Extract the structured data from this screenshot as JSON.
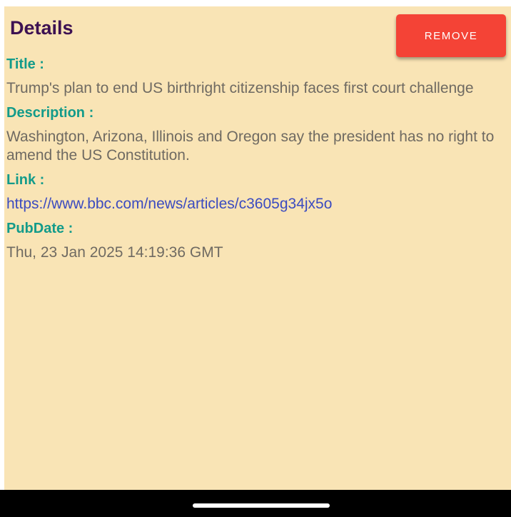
{
  "header": {
    "title": "Details",
    "remove_label": "REMOVE"
  },
  "details": {
    "title_label": "Title :",
    "title_value": "Trump's plan to end US birthright citizenship faces first court challenge",
    "description_label": "Description :",
    "description_value": "Washington, Arizona, Illinois and Oregon say the president has no right to amend the US Constitution.",
    "link_label": "Link :",
    "link_value": "https://www.bbc.com/news/articles/c3605g34jx5o",
    "pubdate_label": "PubDate :",
    "pubdate_value": "Thu, 23 Jan 2025 14:19:36 GMT"
  },
  "colors": {
    "background": "#f9e4b5",
    "header_text": "#3d1152",
    "label_text": "#139b8a",
    "value_text": "#6f6a62",
    "link_text": "#3b4bc0",
    "remove_button": "#f44336",
    "nav_bar": "#000000"
  }
}
